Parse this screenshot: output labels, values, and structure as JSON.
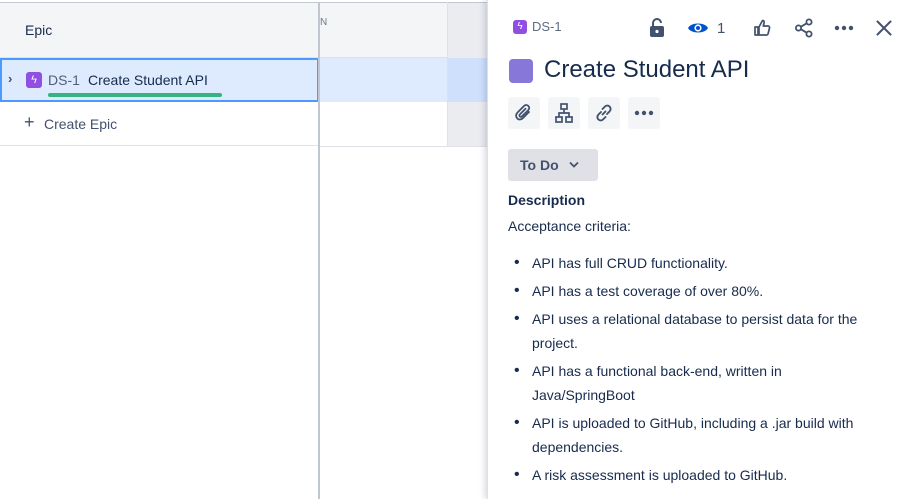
{
  "table": {
    "header_label": "Epic",
    "col_fragment": "N",
    "epic": {
      "key": "DS-1",
      "name": "Create Student API",
      "icon": "lightning-icon",
      "expand_icon": "chevron-right-icon",
      "progress_color": "#36B37E"
    },
    "create_label": "Create Epic"
  },
  "panel": {
    "breadcrumb_key": "DS-1",
    "watch_count": "1",
    "title": "Create Student API",
    "status": "To Do",
    "description_label": "Description",
    "description_intro": "Acceptance criteria:",
    "criteria": [
      "API has full CRUD functionality.",
      "API has a test coverage of over 80%.",
      "API uses a relational database to persist data for the project.",
      "API has a functional back-end, written in Java/SpringBoot",
      "API is uploaded to GitHub, including a .jar build with dependencies.",
      "A risk assessment is uploaded to GitHub."
    ],
    "toolbar_icons": [
      "unlock-icon",
      "eye-icon",
      "thumbs-up-icon",
      "share-icon",
      "more-icon",
      "close-icon"
    ],
    "action_icons": [
      "attachment-icon",
      "child-issues-icon",
      "link-icon",
      "more-icon"
    ]
  },
  "colors": {
    "epic_purple": "#904EE2",
    "selection": "#DEEBFF",
    "selection_border": "#4C9AFF"
  }
}
